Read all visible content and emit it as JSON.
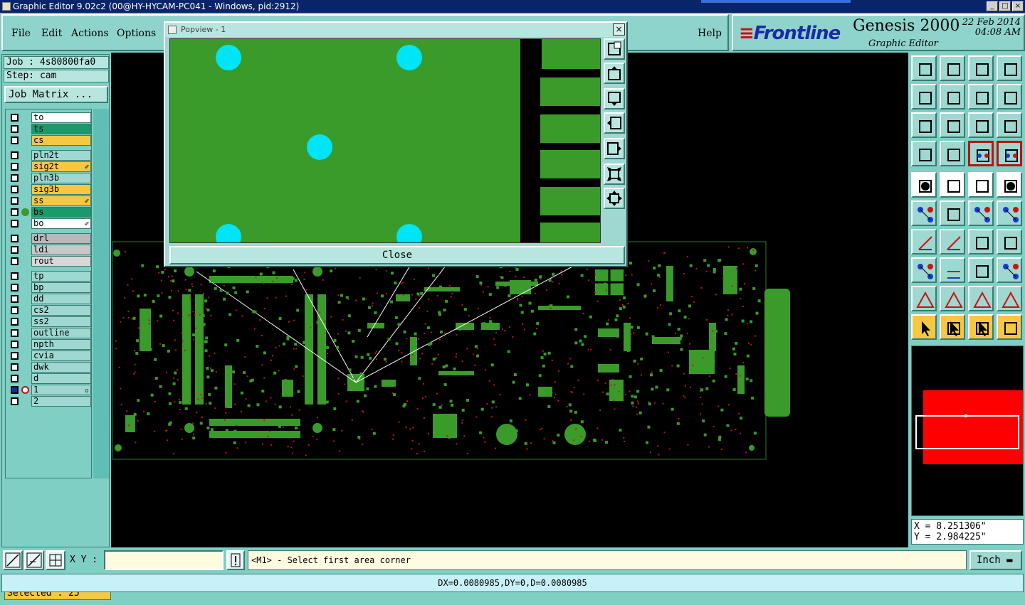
{
  "window": {
    "title": "Graphic Editor 9.02c2 (00@HY-HYCAM-PC041 - Windows, pid:2912)"
  },
  "menu": {
    "file": "File",
    "edit": "Edit",
    "actions": "Actions",
    "options": "Options",
    "help": "Help"
  },
  "logo": {
    "brand_main": "Frontline",
    "product": "Genesis 2000",
    "subtitle": "Graphic Editor",
    "date": "22 Feb 2014",
    "time": "04:08 AM"
  },
  "job": {
    "job_line": "Job : 4s80800fa0",
    "step_line": "Step: cam",
    "matrix_button": "Job Matrix ..."
  },
  "layers": [
    {
      "name": "to",
      "color": "#ffffff",
      "edit": ""
    },
    {
      "name": "ts",
      "color": "#1a9a6a",
      "edit": ""
    },
    {
      "name": "cs",
      "color": "#f5c842",
      "edit": ""
    },
    {
      "name": "pln2t",
      "color": "#9ed8d0",
      "edit": ""
    },
    {
      "name": "sig2t",
      "color": "#f5c842",
      "edit": "✐"
    },
    {
      "name": "pln3b",
      "color": "#9ed8d0",
      "edit": ""
    },
    {
      "name": "sig3b",
      "color": "#f5c842",
      "edit": ""
    },
    {
      "name": "ss",
      "color": "#f5c842",
      "edit": "✐"
    },
    {
      "name": "bs",
      "color": "#1a9a6a",
      "edit": ""
    },
    {
      "name": "bo",
      "color": "#ffffff",
      "edit": "✐"
    },
    {
      "name": "drl",
      "color": "#b8b8b8",
      "edit": ""
    },
    {
      "name": "ldi",
      "color": "#c8c8c8",
      "edit": ""
    },
    {
      "name": "rout",
      "color": "#d8d8d8",
      "edit": ""
    },
    {
      "name": "tp",
      "color": "#9ed8d0",
      "edit": ""
    },
    {
      "name": "bp",
      "color": "#9ed8d0",
      "edit": ""
    },
    {
      "name": "dd",
      "color": "#9ed8d0",
      "edit": ""
    },
    {
      "name": "cs2",
      "color": "#9ed8d0",
      "edit": ""
    },
    {
      "name": "ss2",
      "color": "#9ed8d0",
      "edit": ""
    },
    {
      "name": "outline",
      "color": "#9ed8d0",
      "edit": ""
    },
    {
      "name": "npth",
      "color": "#9ed8d0",
      "edit": ""
    },
    {
      "name": "cvia",
      "color": "#9ed8d0",
      "edit": ""
    },
    {
      "name": "dwk",
      "color": "#9ed8d0",
      "edit": ""
    },
    {
      "name": "d",
      "color": "#9ed8d0",
      "edit": ""
    },
    {
      "name": "1",
      "color": "#9ed8d0",
      "edit": "▫"
    },
    {
      "name": "2",
      "color": "#9ed8d0",
      "edit": ""
    }
  ],
  "selected": "Selected : 25",
  "popview": {
    "title": "Popview - 1",
    "close_label": "Close"
  },
  "coords": {
    "x": "X = 8.251306\"",
    "y": "Y = 2.984225\""
  },
  "bottom": {
    "xy_label": "X Y :",
    "xy_value": "",
    "prompt": "<M1> - Select first area corner",
    "unit": "Inch"
  },
  "status": "DX=0.0080985,DY=0,D=0.0080985"
}
